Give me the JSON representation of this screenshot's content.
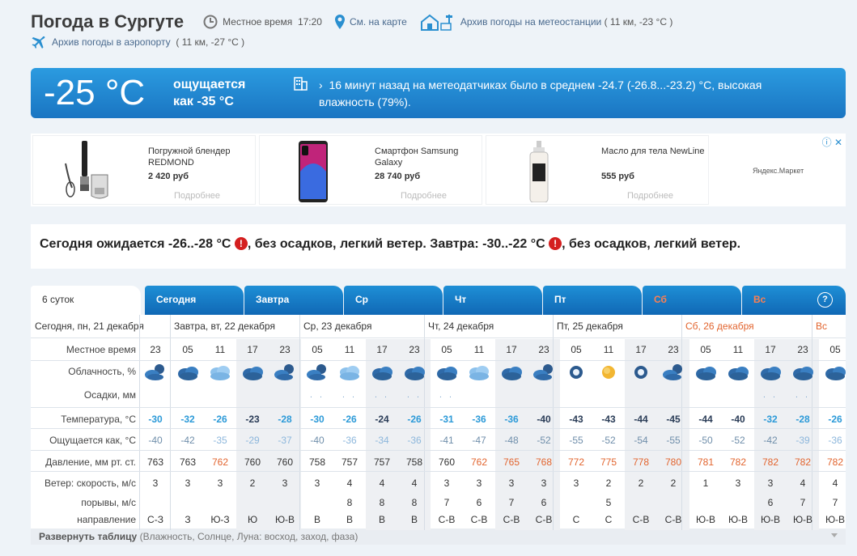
{
  "header": {
    "title": "Погода в Сургуте",
    "local_time_label": "Местное время",
    "local_time": "17:20",
    "map_link": "См. на карте",
    "station_archive": "Архив погоды на метеостанции",
    "station_info": "( 11 км, -23 °C )",
    "airport_archive": "Архив погоды в аэропорту",
    "airport_info": "( 11 км, -27 °C )"
  },
  "now": {
    "temp": "-25 °C",
    "feels_line1": "ощущается",
    "feels_line2": "как -35 °C",
    "note": "16 минут назад на метеодатчиках было в среднем -24.7 (-26.8...-23.2) °C, высокая влажность (79%)."
  },
  "ads": [
    {
      "name": "Погружной блендер REDMOND",
      "price": "2 420 руб",
      "more": "Подробнее"
    },
    {
      "name": "Смартфон Samsung Galaxy",
      "price": "28 740 руб",
      "more": "Подробнее"
    },
    {
      "name": "Масло для тела NewLine",
      "price": "555 руб",
      "more": "Подробнее"
    }
  ],
  "ad_source": "Яндекс.Маркет",
  "forecast": {
    "today": "Сегодня ожидается -26..-28 °C",
    "today_rest": ", без осадков, легкий ветер. Завтра: -30..-22 °C",
    "tomorrow_rest": ", без осадков, легкий ветер."
  },
  "tabs": [
    "6 суток",
    "Сегодня",
    "Завтра",
    "Ср",
    "Чт",
    "Пт",
    "Сб",
    "Вс"
  ],
  "help_icon": "?",
  "day_headers": [
    "Сегодня, пн, 21 декабря",
    "Завтра, вт, 22 декабря",
    "Ср, 23 декабря",
    "Чт, 24 декабря",
    "Пт, 25 декабря",
    "Сб, 26 декабря",
    "Вс"
  ],
  "labels": {
    "time": "Местное время",
    "clouds": "Облачность, %",
    "precip": "Осадки, мм",
    "temp": "Температура, °C",
    "feels": "Ощущается как, °C",
    "pressure": "Давление, мм рт. ст.",
    "wind": "Ветер: скорость, м/с",
    "gusts": "порывы, м/с",
    "direction": "направление"
  },
  "hours": [
    "23",
    "05",
    "11",
    "17",
    "23",
    "05",
    "11",
    "17",
    "23",
    "05",
    "11",
    "17",
    "23",
    "05",
    "11",
    "17",
    "23",
    "05",
    "11",
    "17",
    "23",
    "05"
  ],
  "cloud_icons": [
    "night-cloud-icon",
    "cloud-icon",
    "overcast-icon",
    "cloud-icon",
    "night-cloud-icon",
    "night-cloud-icon",
    "overcast-icon",
    "cloud-icon",
    "cloud-icon",
    "cloud-icon",
    "overcast-icon",
    "cloud-icon",
    "night-cloud-icon",
    "moon-icon",
    "sun-icon",
    "moon-icon",
    "night-cloud-icon",
    "cloud-icon",
    "cloud-icon",
    "cloud-icon",
    "cloud-icon",
    "cloud-icon"
  ],
  "precip": [
    "",
    "",
    "",
    "",
    "",
    "*",
    "*",
    "*",
    "*",
    "*",
    "",
    "",
    "",
    "",
    "",
    "",
    "",
    "",
    "",
    "*",
    "*",
    ""
  ],
  "temperature": [
    "-30",
    "-32",
    "-26",
    "-23",
    "-28",
    "-30",
    "-26",
    "-24",
    "-26",
    "-31",
    "-36",
    "-36",
    "-40",
    "-43",
    "-43",
    "-44",
    "-45",
    "-44",
    "-40",
    "-32",
    "-28",
    "-26"
  ],
  "feels_like": [
    "-40",
    "-42",
    "-35",
    "-29",
    "-37",
    "-40",
    "-36",
    "-34",
    "-36",
    "-41",
    "-47",
    "-48",
    "-52",
    "-55",
    "-52",
    "-54",
    "-55",
    "-50",
    "-52",
    "-42",
    "-39",
    "-36"
  ],
  "pressure": [
    "763",
    "763",
    "762",
    "760",
    "760",
    "758",
    "757",
    "757",
    "758",
    "760",
    "762",
    "765",
    "768",
    "772",
    "775",
    "778",
    "780",
    "781",
    "782",
    "782",
    "782",
    "782"
  ],
  "wind": [
    "3",
    "3",
    "3",
    "2",
    "3",
    "3",
    "4",
    "4",
    "4",
    "3",
    "3",
    "3",
    "3",
    "3",
    "2",
    "2",
    "2",
    "1",
    "3",
    "3",
    "4",
    "4"
  ],
  "gusts": [
    "",
    "",
    "",
    "",
    "",
    "",
    "8",
    "8",
    "8",
    "7",
    "6",
    "7",
    "6",
    "",
    "5",
    "",
    "",
    "",
    "",
    "6",
    "7",
    "7"
  ],
  "direction": [
    "С-З",
    "З",
    "Ю-З",
    "Ю",
    "Ю-В",
    "В",
    "В",
    "В",
    "В",
    "С-В",
    "С-В",
    "С-В",
    "С-В",
    "С",
    "С",
    "С-В",
    "С-В",
    "Ю-В",
    "Ю-В",
    "Ю-В",
    "Ю-В",
    "Ю-В"
  ],
  "expand": {
    "bold": "Развернуть таблицу",
    "rest": " (Влажность, Солнце, Луна: восход, заход, фаза)"
  },
  "colors": {
    "accent": "#1e8fd6",
    "warning": "#d41f1f",
    "pressure_high": "#e2642e"
  }
}
